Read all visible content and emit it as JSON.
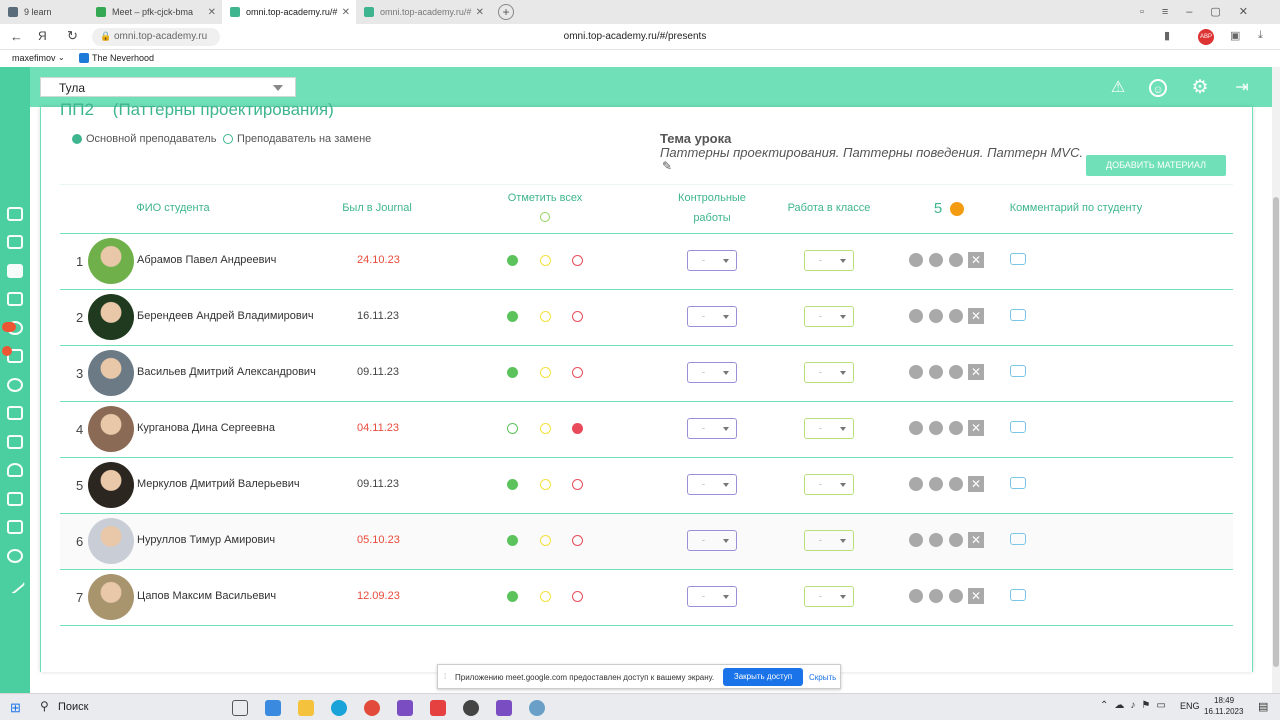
{
  "browser": {
    "tabs": [
      {
        "label": "9 learn",
        "color": "#5a6b7a"
      },
      {
        "label": "Meet – pfk-cjck-bma",
        "color": "#34a853"
      },
      {
        "label": "omni.top-academy.ru/#",
        "color": "#3fb58f"
      },
      {
        "label": "omni.top-academy.ru/#",
        "color": "#3fb58f"
      }
    ],
    "address_short": "omni.top-academy.ru",
    "address_full": "omni.top-academy.ru/#/presents",
    "bookmarks": [
      "maxefimov",
      "The Neverhood"
    ]
  },
  "header": {
    "city": "Тула",
    "icons": [
      "warning-icon",
      "smiley-icon",
      "gear-icon",
      "logout-icon"
    ]
  },
  "lesson": {
    "group_title": "ПП2    (Паттерны проектирования)",
    "legend_main": "Основной преподаватель",
    "legend_sub": "Преподаватель на замене",
    "topic_label": "Тема урока",
    "topic_text": "Паттерны проектирования. Паттерны поведения. Паттерн MVC.",
    "add_material": "ДОБАВИТЬ МАТЕРИАЛ"
  },
  "table": {
    "col_name": "ФИО студента",
    "col_journal": "Был в Journal",
    "col_mark_all": "Отметить всех",
    "col_control_1": "Контрольные",
    "col_control_2": "работы",
    "col_classwork": "Работа в классе",
    "col_coins": "5",
    "col_comment": "Комментарий по студенту",
    "select_placeholder": "-",
    "rows": [
      {
        "n": "1",
        "name": "Абрамов Павел Андреевич",
        "date": "24.10.23",
        "late": true,
        "status": "present",
        "av": "#6fb04a"
      },
      {
        "n": "2",
        "name": "Берендеев Андрей Владимирович",
        "date": "16.11.23",
        "late": false,
        "status": "present",
        "av": "#1f3a1f"
      },
      {
        "n": "3",
        "name": "Васильев Дмитрий Александрович",
        "date": "09.11.23",
        "late": false,
        "status": "present",
        "av": "#6b7a85"
      },
      {
        "n": "4",
        "name": "Курганова Дина Сергеевна",
        "date": "04.11.23",
        "late": true,
        "status": "absent",
        "av": "#8a6a55"
      },
      {
        "n": "5",
        "name": "Меркулов Дмитрий Валерьевич",
        "date": "09.11.23",
        "late": false,
        "status": "present",
        "av": "#2c2620"
      },
      {
        "n": "6",
        "name": "Нуруллов Тимур Амирович",
        "date": "05.10.23",
        "late": true,
        "status": "present",
        "av": "#c9ced6"
      },
      {
        "n": "7",
        "name": "Цапов Максим Васильевич",
        "date": "12.09.23",
        "late": true,
        "status": "present",
        "av": "#a8956e"
      }
    ]
  },
  "notification": {
    "text": "Приложению meet.google.com предоставлен доступ к вашему экрану.",
    "stop_button": "Закрыть доступ",
    "hide_link": "Скрыть"
  },
  "taskbar": {
    "search": "Поиск",
    "lang": "ENG",
    "time": "18:49",
    "date": "16.11.2023"
  },
  "colors": {
    "accent": "#4ccfa0",
    "header": "#6fe0b8",
    "green": "#5cc35c",
    "yellow": "#f5e23c",
    "red": "#e94b5a",
    "late_date": "#e94b3c"
  }
}
